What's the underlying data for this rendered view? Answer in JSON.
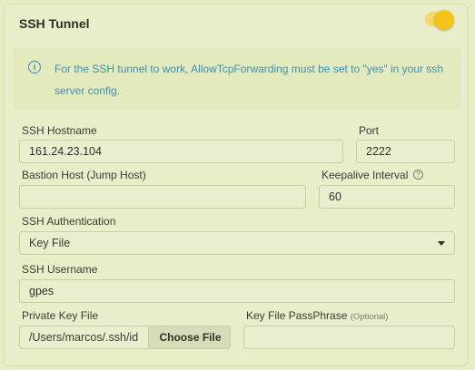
{
  "header": {
    "title": "SSH Tunnel",
    "toggle_on": true,
    "toggle_color": "#f4c419"
  },
  "info": {
    "icon": "info-icon",
    "text": "For the SSH tunnel to work, AllowTcpForwarding must be set to \"yes\" in your ssh server config.",
    "color": "#3a8fb4"
  },
  "fields": {
    "hostname": {
      "label": "SSH Hostname",
      "value": "161.24.23.104"
    },
    "port": {
      "label": "Port",
      "value": "2222"
    },
    "bastion": {
      "label": "Bastion Host (Jump Host)",
      "value": ""
    },
    "keepalive": {
      "label": "Keepalive Interval",
      "value": "60",
      "help_icon": "question-icon"
    },
    "auth": {
      "label": "SSH Authentication",
      "value": "Key File"
    },
    "username": {
      "label": "SSH Username",
      "value": "gpes"
    },
    "private_key": {
      "label": "Private Key File",
      "value": "/Users/marcos/.ssh/id",
      "button": "Choose File"
    },
    "passphrase": {
      "label": "Key File PassPhrase",
      "optional": "(Optional)",
      "value": ""
    }
  }
}
